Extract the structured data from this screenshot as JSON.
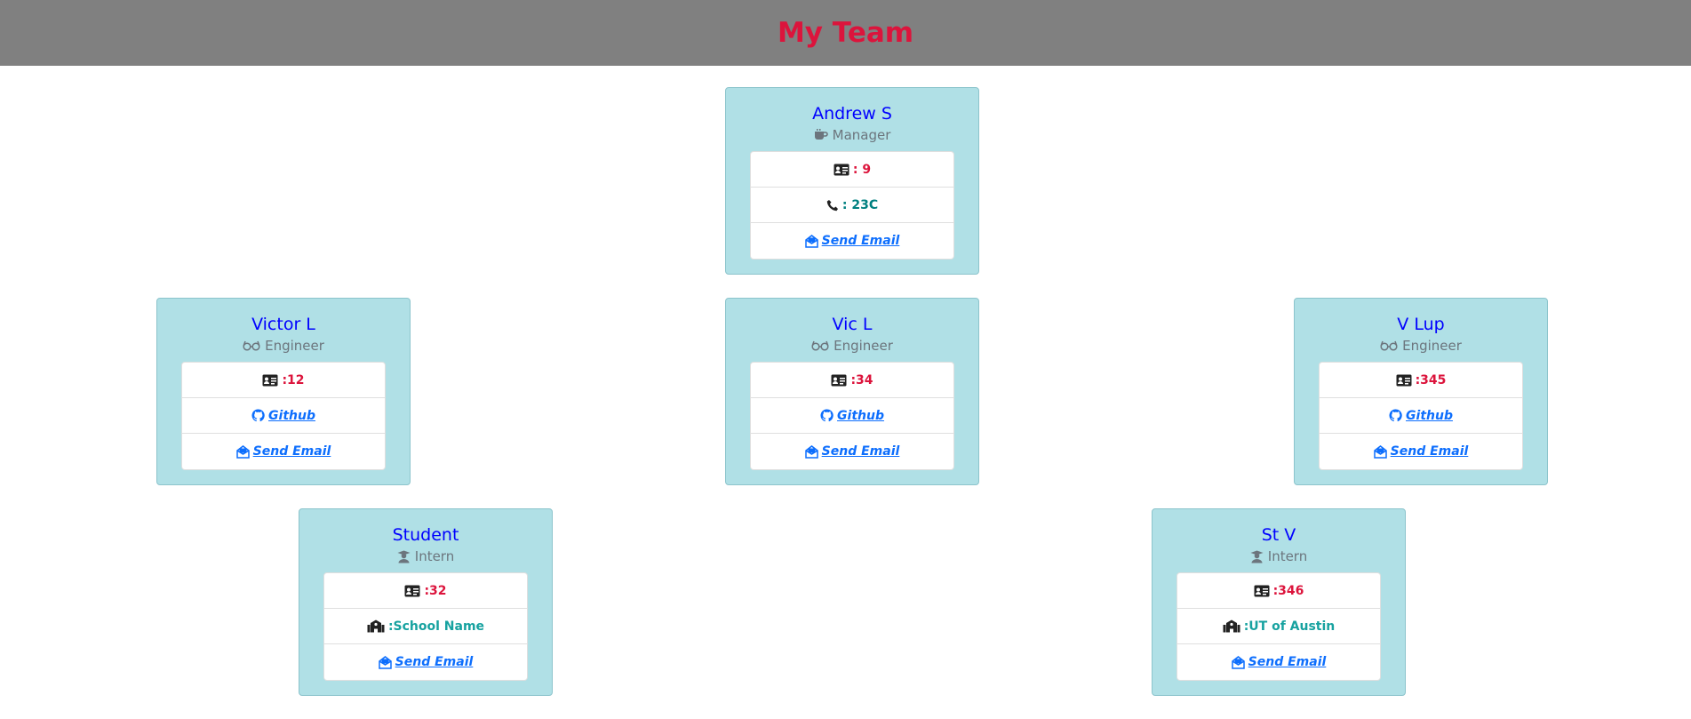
{
  "header": {
    "title": "My Team"
  },
  "manager": {
    "name": "Andrew S",
    "role": "Manager",
    "id_value": ": 9",
    "office_value": ": 23C",
    "email_label": "Send Email"
  },
  "engineers": [
    {
      "name": "Victor L",
      "role": "Engineer",
      "id_value": ":12",
      "github_label": " Github",
      "email_label": "Send Email"
    },
    {
      "name": "Vic L",
      "role": "Engineer",
      "id_value": ":34",
      "github_label": " Github",
      "email_label": "Send Email"
    },
    {
      "name": "V Lup",
      "role": "Engineer",
      "id_value": ":345",
      "github_label": " Github",
      "email_label": "Send Email"
    }
  ],
  "interns": [
    {
      "name": "Student",
      "role": "Intern",
      "id_value": ":32",
      "school_value": ":School Name",
      "email_label": "Send Email"
    },
    {
      "name": "St V",
      "role": "Intern",
      "id_value": ":346",
      "school_value": ":UT of Austin",
      "email_label": "Send Email"
    }
  ],
  "colors": {
    "header_bg": "#808080",
    "title": "#dc143c",
    "card_bg": "#b0e0e6",
    "name": "#0000ff",
    "id_value": "#dc143c",
    "link": "#0d6efd"
  },
  "icons": {
    "manager_role": "coffee-icon",
    "engineer_role": "glasses-icon",
    "intern_role": "graduate-icon",
    "id": "id-card-icon",
    "office": "phone-icon",
    "github": "github-icon",
    "email": "envelope-open-icon",
    "school": "school-icon"
  }
}
